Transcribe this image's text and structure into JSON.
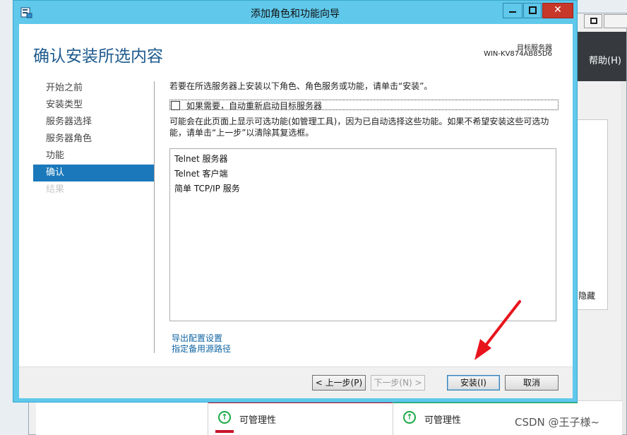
{
  "background": {
    "help_menu": "帮助(H)",
    "hide_label": "隐藏",
    "tile_1_label": "可管理性",
    "tile_2_label": "可管理性",
    "tile_icon": "up-arrow-circle-icon",
    "colors": {
      "header": "#363a3f",
      "tile_red": "#c8142b",
      "tile_green": "#1aaa44"
    }
  },
  "wizard": {
    "title": "添加角色和功能向导",
    "page_title": "确认安装所选内容",
    "target_server_label": "目标服务器",
    "target_server_value": "WIN-KV874AB85D6",
    "nav": [
      {
        "label": "开始之前",
        "state": "normal"
      },
      {
        "label": "安装类型",
        "state": "normal"
      },
      {
        "label": "服务器选择",
        "state": "normal"
      },
      {
        "label": "服务器角色",
        "state": "normal"
      },
      {
        "label": "功能",
        "state": "normal"
      },
      {
        "label": "确认",
        "state": "active"
      },
      {
        "label": "结果",
        "state": "disabled"
      }
    ],
    "intro_text": "若要在所选服务器上安装以下角色、角色服务或功能，请单击“安装”。",
    "restart_checkbox_label": "如果需要，自动重新启动目标服务器",
    "restart_checked": false,
    "note_text": "可能会在此页面上显示可选功能(如管理工具)，因为已自动选择这些功能。如果不希望安装这些可选功能，请单击“上一步”以清除其复选框。",
    "features": [
      "Telnet 服务器",
      "Telnet 客户端",
      "简单 TCP/IP 服务"
    ],
    "export_link": "导出配置设置",
    "alt_source_link": "指定备用源路径",
    "buttons": {
      "prev": "< 上一步(P)",
      "next": "下一步(N) >",
      "install": "安装(I)",
      "cancel": "取消"
    },
    "colors": {
      "titlebar": "#5fc8eb",
      "accent": "#1b79bb",
      "title_text": "#1d5a8e",
      "close": "#c7372a",
      "link": "#1064a3"
    }
  },
  "watermark": "CSDN @王子様~",
  "annotation_color": "#e8141c"
}
